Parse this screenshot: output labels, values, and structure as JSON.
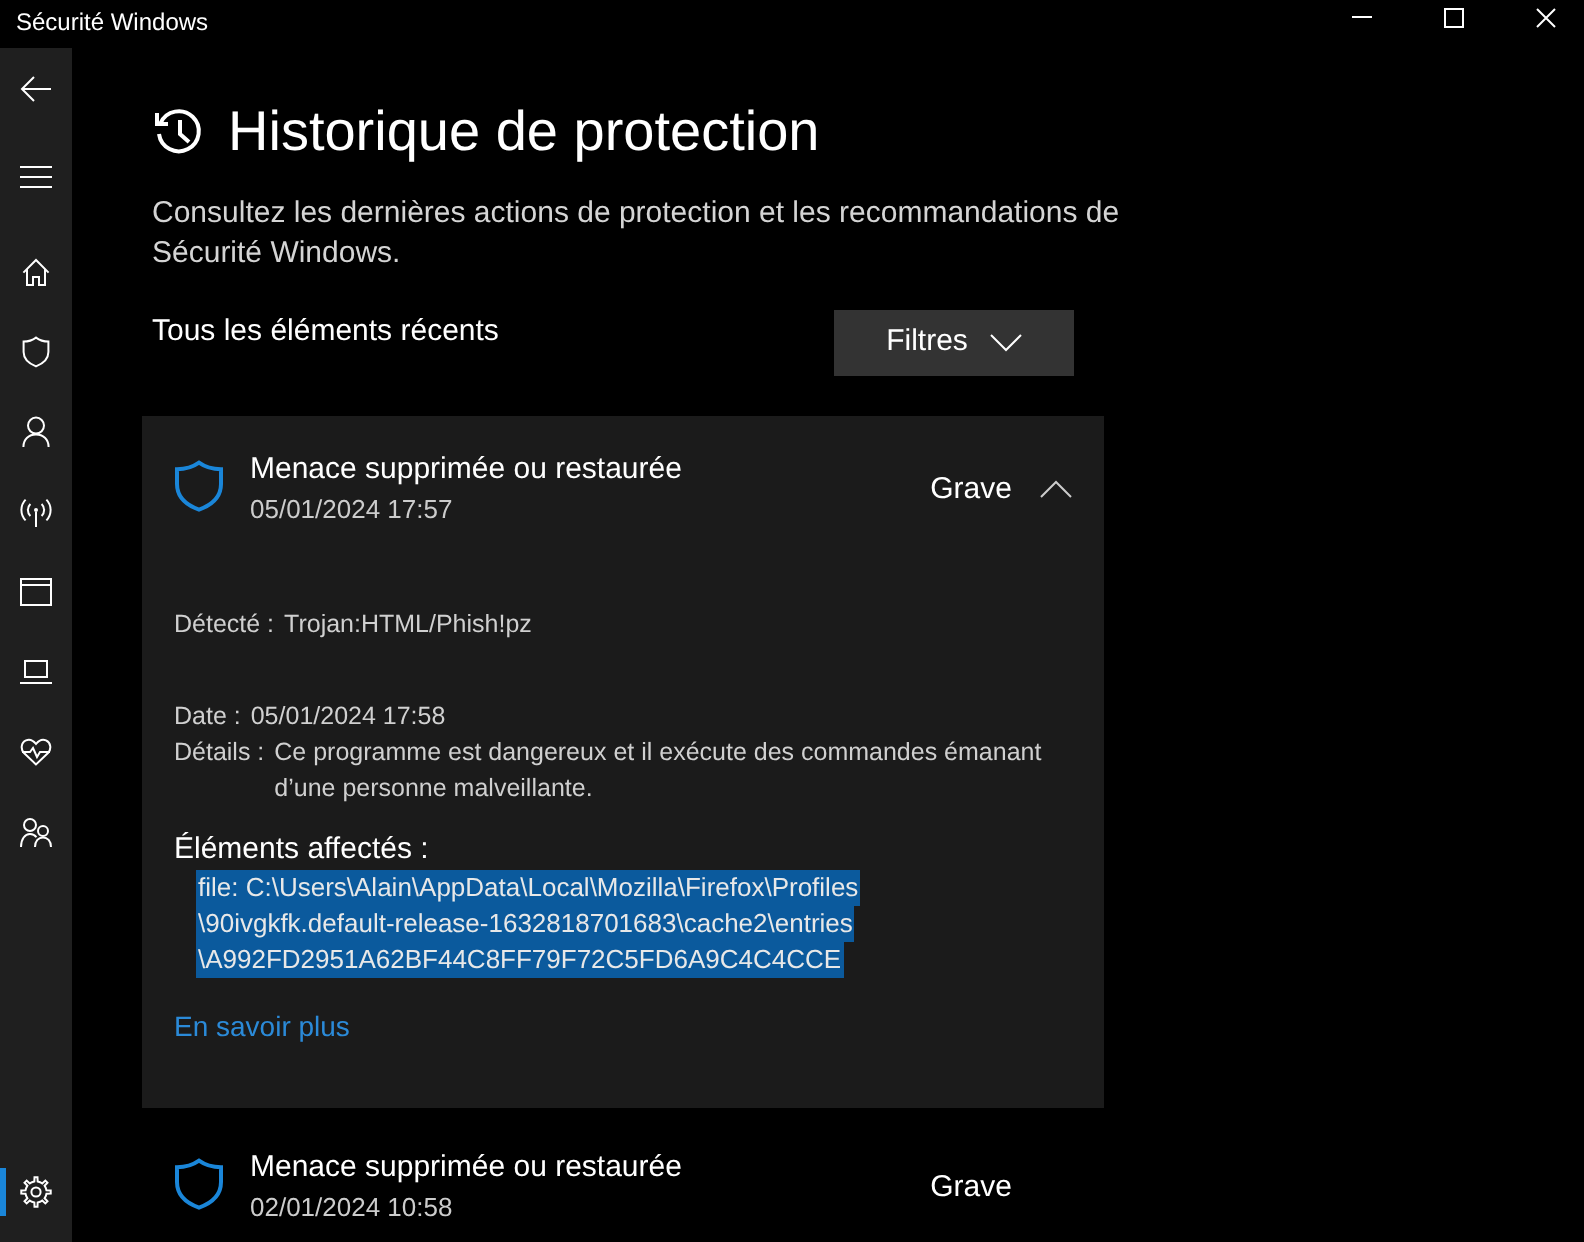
{
  "window": {
    "title": "Sécurité Windows"
  },
  "sidebar": {
    "items": [
      {
        "selected": false
      },
      {
        "selected": false
      },
      {
        "selected": false
      },
      {
        "selected": false
      },
      {
        "selected": false
      },
      {
        "selected": false
      },
      {
        "selected": false
      },
      {
        "selected": false
      }
    ],
    "bottom_items": [
      {
        "selected": true
      }
    ]
  },
  "page": {
    "title": "Historique de protection",
    "description": "Consultez les dernières actions de protection et les recommandations de Sécurité Windows.",
    "section_title": "Tous les éléments récents",
    "filter_button": "Filtres"
  },
  "history": [
    {
      "title": "Menace supprimée ou restaurée",
      "timestamp": "05/01/2024 17:57",
      "severity": "Grave",
      "expanded": true,
      "detected": {
        "label": "Détecté :",
        "value": "Trojan:HTML/Phish!pz"
      },
      "fields": [
        {
          "label": "Date :",
          "value": "05/01/2024 17:58"
        },
        {
          "label": "Détails :",
          "value": "Ce programme est dangereux et il exécute des commandes émanant d’une personne malveillante."
        }
      ],
      "affected": {
        "label": "Éléments affectés :",
        "selected": true,
        "lines": [
          "file: C:\\Users\\Alain\\AppData\\Local\\Mozilla\\Firefox\\Profiles",
          "\\90ivgkfk.default-release-1632818701683\\cache2\\entries",
          "\\A992FD2951A62BF44C8FF79F72C5FD6A9C4C4CCE"
        ]
      },
      "link": "En savoir plus"
    },
    {
      "title": "Menace supprimée ou restaurée",
      "timestamp": "02/01/2024 10:58",
      "severity": "Grave",
      "expanded": false
    }
  ]
}
